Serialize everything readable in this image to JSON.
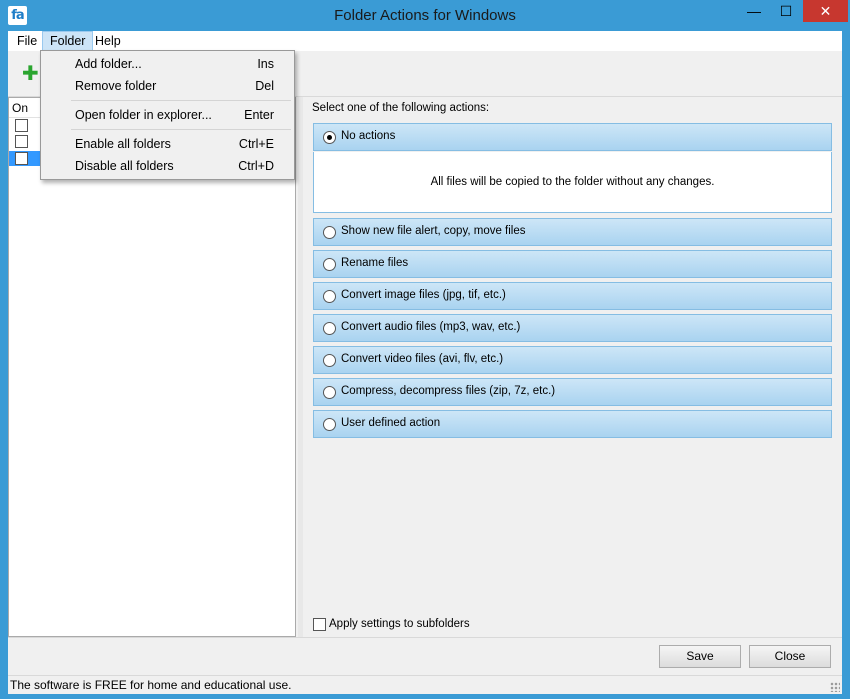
{
  "window": {
    "title": "Folder Actions for Windows",
    "app_icon": "fa"
  },
  "menubar": {
    "file": "File",
    "folder": "Folder",
    "help": "Help"
  },
  "folder_menu": {
    "items": [
      {
        "label": "Add folder...",
        "shortcut": "Ins"
      },
      {
        "label": "Remove folder",
        "shortcut": "Del"
      },
      {
        "label": "Open folder in explorer...",
        "shortcut": "Enter"
      },
      {
        "label": "Enable all folders",
        "shortcut": "Ctrl+E"
      },
      {
        "label": "Disable all folders",
        "shortcut": "Ctrl+D"
      }
    ]
  },
  "folder_list": {
    "column_on": "On"
  },
  "actions": {
    "instruction": "Select one of the following actions:",
    "selected": "No actions",
    "items": [
      "No actions",
      "Show new file alert, copy, move files",
      "Rename files",
      "Convert image files (jpg, tif, etc.)",
      "Convert audio files (mp3, wav, etc.)",
      "Convert video files (avi, flv, etc.)",
      "Compress, decompress files (zip, 7z, etc.)",
      "User defined action"
    ],
    "description": "All files will be copied to the folder without any changes."
  },
  "apply_subfolders": "Apply settings to subfolders",
  "buttons": {
    "save": "Save",
    "close": "Close"
  },
  "status": "The software is FREE for home and educational use.",
  "colors": {
    "titlebar": "#3a9bd5",
    "close_button": "#c7372f",
    "selection": "#3399ff",
    "action_band": "#a9d3f0",
    "add_icon": "#2aa52f"
  }
}
